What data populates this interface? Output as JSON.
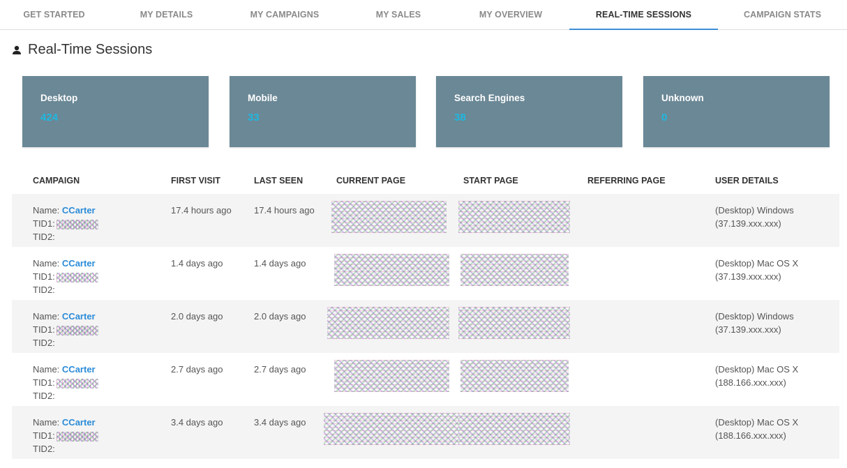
{
  "tabs": [
    {
      "label": "GET STARTED",
      "active": false
    },
    {
      "label": "MY DETAILS",
      "active": false
    },
    {
      "label": "MY CAMPAIGNS",
      "active": false
    },
    {
      "label": "MY SALES",
      "active": false
    },
    {
      "label": "MY OVERVIEW",
      "active": false
    },
    {
      "label": "REAL-TIME SESSIONS",
      "active": true
    },
    {
      "label": "CAMPAIGN STATS",
      "active": false
    }
  ],
  "page": {
    "title": "Real-Time Sessions",
    "title_icon": "person-icon"
  },
  "colors": {
    "card_bg": "#6b8896",
    "card_value": "#1fb8e0",
    "link": "#2a8bd8",
    "active_tab_underline": "#3d8fd6"
  },
  "stats": [
    {
      "label": "Desktop",
      "value": "424"
    },
    {
      "label": "Mobile",
      "value": "33"
    },
    {
      "label": "Search Engines",
      "value": "38"
    },
    {
      "label": "Unknown",
      "value": "0"
    }
  ],
  "table": {
    "headers": [
      "CAMPAIGN",
      "FIRST VISIT",
      "LAST SEEN",
      "CURRENT PAGE",
      "START PAGE",
      "REFERRING PAGE",
      "USER DETAILS"
    ],
    "name_label": "Name:",
    "tid1_label": "TID1:",
    "tid2_label": "TID2:",
    "rows": [
      {
        "name": "CCarter",
        "first_visit": "17.4 hours ago",
        "last_seen": "17.4 hours ago",
        "referring_page": "",
        "device": "(Desktop) Windows",
        "ip": "(37.139.xxx.xxx)"
      },
      {
        "name": "CCarter",
        "first_visit": "1.4 days ago",
        "last_seen": "1.4 days ago",
        "referring_page": "",
        "device": "(Desktop) Mac OS X",
        "ip": "(37.139.xxx.xxx)"
      },
      {
        "name": "CCarter",
        "first_visit": "2.0 days ago",
        "last_seen": "2.0 days ago",
        "referring_page": "",
        "device": "(Desktop) Windows",
        "ip": "(37.139.xxx.xxx)"
      },
      {
        "name": "CCarter",
        "first_visit": "2.7 days ago",
        "last_seen": "2.7 days ago",
        "referring_page": "",
        "device": "(Desktop) Mac OS X",
        "ip": "(188.166.xxx.xxx)"
      },
      {
        "name": "CCarter",
        "first_visit": "3.4 days ago",
        "last_seen": "3.4 days ago",
        "referring_page": "",
        "device": "(Desktop) Mac OS X",
        "ip": "(188.166.xxx.xxx)"
      }
    ]
  }
}
